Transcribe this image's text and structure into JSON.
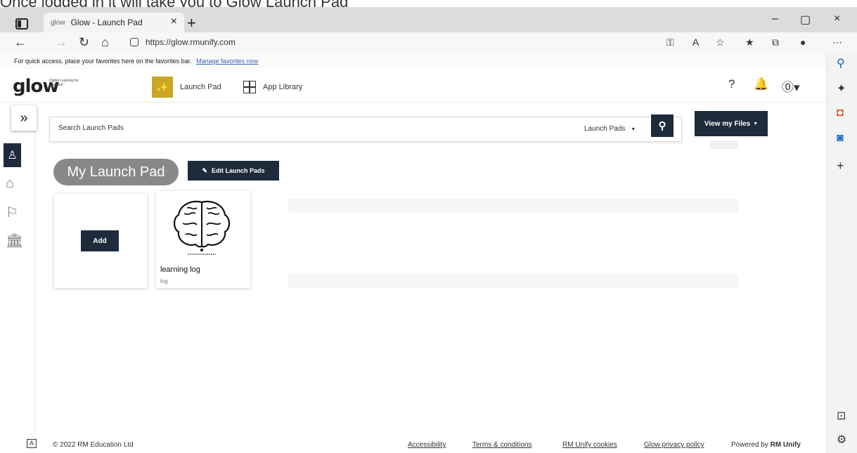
{
  "page_caption": "Once logged in it will take you to Glow Launch Pad",
  "browser": {
    "tab_title": "Glow - Launch Pad",
    "tab_favicon": "glow",
    "tab_close": "×",
    "new_tab": "+",
    "url": "https://glow.rmunify.com",
    "favorites_text": "For quick access, place your favorites here on the favorites bar.",
    "favorites_link": "Manage favorites now",
    "window_minimize": "–",
    "window_restore": "▢",
    "window_close": "×"
  },
  "app": {
    "logo": "glow",
    "logo_sub": "Digital Learning for Scotland",
    "nav_launch_pad": "Launch Pad",
    "nav_app_library": "App Library",
    "search_placeholder": "Search Launch Pads",
    "search_scope": "Launch Pads",
    "view_files": "View my Files",
    "launch_pad_title": "My Launch Pad",
    "edit_button": "Edit Launch Pads",
    "add_button": "Add",
    "app_tile": {
      "title": "learning log",
      "subtitle": "log"
    }
  },
  "footer": {
    "a_icon": "A",
    "copyright": "© 2022 RM Education Ltd",
    "accessibility": "Accessibility",
    "terms": "Terms & conditions",
    "cookies": "RM Unify cookies",
    "privacy": "Glow privacy policy",
    "powered_prefix": "Powered by",
    "powered_brand": "RM Unify"
  },
  "colors": {
    "navy": "#1d2b3a",
    "launch_pad_badge": "#c9a626",
    "pill_gray": "#888888"
  }
}
